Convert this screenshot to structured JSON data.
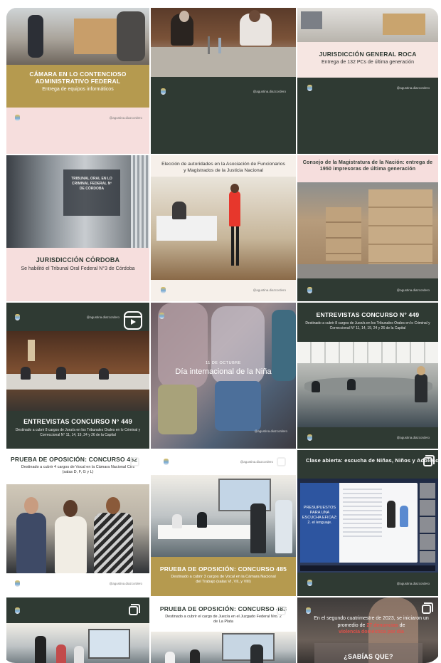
{
  "handle": "@agustina.diazcordero",
  "tiles": [
    {
      "title": "CÁMARA EN LO CONTENCIOSO ADMINISTRATIVO FEDERAL",
      "subtitle": "Entrega de equipos informáticos"
    },
    {
      "title": "",
      "subtitle": ""
    },
    {
      "title": "JURISDICCIÓN GENERAL ROCA",
      "subtitle": "Entrega de 132 PCs de última generación"
    },
    {
      "title": "JURISDICCIÓN CÓRDOBA",
      "subtitle": "Se habilitó el Tribunal Oral Federal N°3 de Córdoba",
      "sign_line1": "TRIBUNAL ORAL EN LO",
      "sign_line2": "CRIMINAL FEDERAL Nº",
      "sign_line3": "DE CÓRDOBA"
    },
    {
      "title": "Elección de autoridades en la Asociación de Funcionarios y Magistrados de la Justicia Nacional"
    },
    {
      "title": "Consejo de la Magistratura de la Nación: entrega de 1950 impresoras de última generación"
    },
    {
      "title": "ENTREVISTAS CONCURSO N° 449",
      "subtitle": "Destinado a cubrir 8 cargos de Juez/a en los Tribunales Orales en lo Criminal y Correccional N° 11, 14, 19, 24 y 26 de la Capital"
    },
    {
      "date": "11 DE OCTUBRE",
      "title": "Día internacional de la Niña"
    },
    {
      "title": "ENTREVISTAS CONCURSO N° 449",
      "subtitle": "Destinado a cubrir 8 cargos de Juez/a en los Tribunales Orales en lo Criminal y Correccional N° 11, 14, 19, 24 y 26 de la Capital"
    },
    {
      "title": "PRUEBA DE OPOSICIÓN: CONCURSO 482",
      "subtitle": "Destinado a cubrir 4 cargos de Vocal en la Cámara Nacional Civil (salas D, F, G y L)"
    },
    {
      "title": "PRUEBA DE OPOSICIÓN: CONCURSO 485",
      "subtitle": "Destinado a cubrir 3 cargos de Vocal en la Cámara Nacional del Trabajo (salas VI, VII, y VIII)"
    },
    {
      "title": "Clase abierta: escucha de Niñas, Niños y Adolescentes en las audiencias judiciales",
      "slide_title": "PRESUPUESTOS PARA UNA ESCUCHA EFICAZ: 2. el lenguaje."
    },
    {
      "title": ""
    },
    {
      "title": "PRUEBA DE OPOSICIÓN: CONCURSO 483",
      "subtitle": "Destinado a cubrir el cargo de Juez/a en el Juzgado Federal Nro. 2 de La Plata"
    },
    {
      "title": "¿SABÍAS QUE?",
      "text_a": "En el segundo cuatrimestre de 2023, se iniciaron un promedio de ",
      "text_highlight_a": "27 denuncias",
      "text_b": " de ",
      "text_highlight_b": "violencia doméstica por día"
    }
  ],
  "colors": {
    "gold": "#b59a4f",
    "dark_green": "#2f3a33",
    "pink": "#f6dedd",
    "red_text": "#e0524a"
  }
}
